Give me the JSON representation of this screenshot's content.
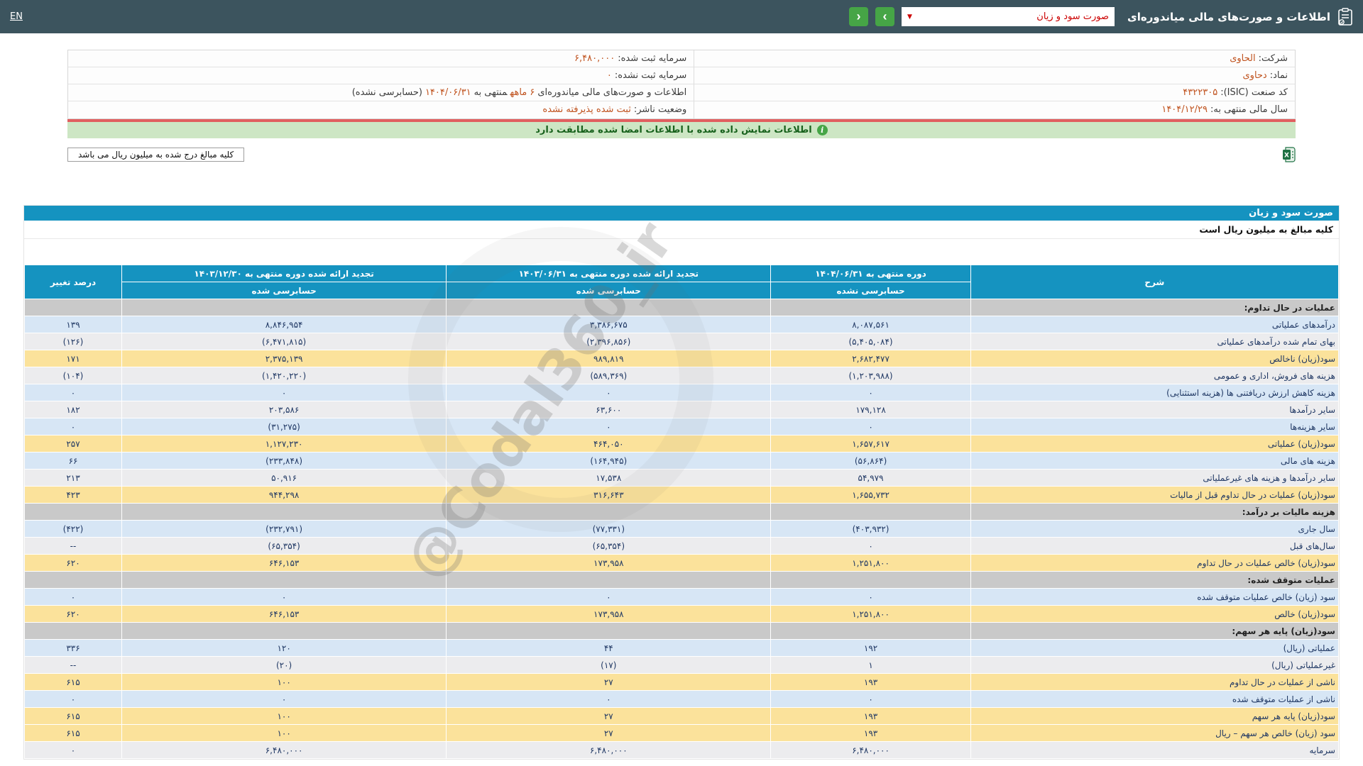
{
  "colors": {
    "header_bg": "#3c545e",
    "cyan": "#1593c0",
    "green_btn": "#46a546",
    "accent": "#c0531f",
    "red_line": "#e15f5f",
    "notice_bg": "#cde6c4",
    "row_blue": "#d7e6f5",
    "row_gray": "#ececee",
    "row_yellow": "#fbe29b",
    "section_gray": "#c9c9c9",
    "val_navy": "#203864",
    "neg_red": "#e00000"
  },
  "header": {
    "title": "اطلاعات و صورت‌های مالی میاندوره‌ای",
    "dropdown_value": "صورت سود و زیان",
    "dropdown_arrow_glyph": "▼",
    "next_glyph": "›",
    "prev_glyph": "‹",
    "lang": "EN",
    "icons": {
      "clipboard": "clipboard-icon",
      "next": "chevron-right-icon",
      "prev": "chevron-left-icon",
      "dropdown": "chevron-down-icon"
    }
  },
  "company_info": {
    "right_rows": [
      {
        "parts": [
          {
            "t": "شرکت:",
            "c": "label"
          },
          {
            "t": "الحاوی",
            "c": "value"
          }
        ]
      },
      {
        "parts": [
          {
            "t": "نماد:",
            "c": "label"
          },
          {
            "t": "دحاوی",
            "c": "value"
          }
        ]
      },
      {
        "parts": [
          {
            "t": "کد صنعت (ISIC):",
            "c": "label"
          },
          {
            "t": "۴۳۲۲۳۰۵",
            "c": "value"
          }
        ]
      },
      {
        "parts": [
          {
            "t": "سال مالی منتهی به:",
            "c": "label"
          },
          {
            "t": "۱۴۰۴/۱۲/۲۹",
            "c": "value"
          }
        ]
      }
    ],
    "left_rows": [
      {
        "parts": [
          {
            "t": "سرمایه ثبت شده:",
            "c": "label"
          },
          {
            "t": "۶,۴۸۰,۰۰۰",
            "c": "value"
          }
        ]
      },
      {
        "parts": [
          {
            "t": "سرمایه ثبت نشده:",
            "c": "label"
          },
          {
            "t": "۰",
            "c": "value"
          }
        ]
      },
      {
        "parts": [
          {
            "t": "اطلاعات و صورت‌های مالی میاندوره‌ای",
            "c": "label"
          },
          {
            "t": "۶ ماهه",
            "c": "value"
          },
          {
            "t": "منتهی به",
            "c": "label"
          },
          {
            "t": "۱۴۰۴/۰۶/۳۱",
            "c": "value"
          },
          {
            "t": "(حسابرسی نشده)",
            "c": "label"
          }
        ]
      },
      {
        "parts": [
          {
            "t": "وضعیت ناشر:",
            "c": "label"
          },
          {
            "t": "ثبت شده پذیرفته نشده",
            "c": "value"
          }
        ]
      }
    ]
  },
  "notice": {
    "icon_glyph": "i",
    "text": "اطلاعات نمایش داده شده با اطلاعات امضا شده مطابقت دارد"
  },
  "unit_note_box": "کلیه مبالغ درج شده به میلیون ریال می باشد",
  "excel_icon": "excel-export-icon",
  "statement": {
    "title": "صورت سود و زیان",
    "unit_note": "کلیه مبالغ به میلیون ریال است"
  },
  "table": {
    "headers": {
      "desc": "شرح",
      "p1": {
        "line1": "دوره منتهی به ۱۴۰۴/۰۶/۳۱",
        "line2": "حسابرسی نشده"
      },
      "p2": {
        "line1": "تجدید ارائه شده دوره منتهی به ۱۴۰۳/۰۶/۳۱",
        "line2": "حسابرسی شده"
      },
      "p3": {
        "line1": "تجدید ارائه شده دوره منتهی به ۱۴۰۳/۱۲/۳۰",
        "line2": "حسابرسی شده"
      },
      "change": "درصد تغییر"
    },
    "rows": [
      {
        "type": "section",
        "label": "عملیات در حال تداوم:"
      },
      {
        "type": "data",
        "bg": "blue",
        "label": "درآمدهای عملیاتی",
        "v1": "۸,۰۸۷,۵۶۱",
        "v2": "۳,۳۸۶,۶۷۵",
        "v3": "۸,۸۴۶,۹۵۴",
        "pct": "۱۳۹"
      },
      {
        "type": "data",
        "bg": "gray",
        "label": "بهای تمام شده درآمدهای عملیاتی",
        "v1": "(۵,۴۰۵,۰۸۴)",
        "v2": "(۲,۳۹۶,۸۵۶)",
        "v3": "(۶,۴۷۱,۸۱۵)",
        "pct": "(۱۲۶)"
      },
      {
        "type": "data",
        "bg": "yellow",
        "label": "سود(زیان) ناخالص",
        "v1": "۲,۶۸۲,۴۷۷",
        "v2": "۹۸۹,۸۱۹",
        "v3": "۲,۳۷۵,۱۳۹",
        "pct": "۱۷۱"
      },
      {
        "type": "data",
        "bg": "gray",
        "label": "هزینه های فروش، اداری و عمومی",
        "v1": "(۱,۲۰۳,۹۸۸)",
        "v2": "(۵۸۹,۳۶۹)",
        "v3": "(۱,۴۲۰,۲۲۰)",
        "pct": "(۱۰۴)"
      },
      {
        "type": "data",
        "bg": "blue",
        "label": "هزینه کاهش ارزش دریافتنی ها (هزینه استثنایی)",
        "v1": "۰",
        "v2": "۰",
        "v3": "۰",
        "pct": "۰"
      },
      {
        "type": "data",
        "bg": "gray",
        "label": "سایر درآمدها",
        "v1": "۱۷۹,۱۲۸",
        "v2": "۶۳,۶۰۰",
        "v3": "۲۰۳,۵۸۶",
        "pct": "۱۸۲"
      },
      {
        "type": "data",
        "bg": "blue",
        "label": "سایر هزینه‌ها",
        "v1": "۰",
        "v2": "۰",
        "v3": "(۳۱,۲۷۵)",
        "pct": "۰"
      },
      {
        "type": "data",
        "bg": "yellow",
        "label": "سود(زیان) عملیاتی",
        "v1": "۱,۶۵۷,۶۱۷",
        "v2": "۴۶۴,۰۵۰",
        "v3": "۱,۱۲۷,۲۳۰",
        "pct": "۲۵۷"
      },
      {
        "type": "data",
        "bg": "blue",
        "label": "هزینه های مالی",
        "v1": "(۵۶,۸۶۴)",
        "v2": "(۱۶۴,۹۴۵)",
        "v3": "(۲۳۳,۸۴۸)",
        "pct": "۶۶"
      },
      {
        "type": "data",
        "bg": "gray",
        "label": "سایر درآمدها و هزینه های غیرعملیاتی",
        "v1": "۵۴,۹۷۹",
        "v2": "۱۷,۵۳۸",
        "v3": "۵۰,۹۱۶",
        "pct": "۲۱۳"
      },
      {
        "type": "data",
        "bg": "yellow",
        "label": "سود(زیان) عملیات در حال تداوم قبل از مالیات",
        "v1": "۱,۶۵۵,۷۳۲",
        "v2": "۳۱۶,۶۴۳",
        "v3": "۹۴۴,۲۹۸",
        "pct": "۴۲۳"
      },
      {
        "type": "section",
        "label": "هزینه مالیات بر درآمد:"
      },
      {
        "type": "data",
        "bg": "blue",
        "label": "سال جاری",
        "v1": "(۴۰۳,۹۳۲)",
        "v2": "(۷۷,۳۳۱)",
        "v3": "(۲۳۲,۷۹۱)",
        "pct": "(۴۲۲)"
      },
      {
        "type": "data",
        "bg": "gray",
        "label": "سال‌های قبل",
        "v1": "۰",
        "v2": "(۶۵,۳۵۴)",
        "v3": "(۶۵,۳۵۴)",
        "pct": "--"
      },
      {
        "type": "data",
        "bg": "yellow",
        "label": "سود(زیان) خالص عملیات در حال تداوم",
        "v1": "۱,۲۵۱,۸۰۰",
        "v2": "۱۷۳,۹۵۸",
        "v3": "۶۴۶,۱۵۳",
        "pct": "۶۲۰"
      },
      {
        "type": "section",
        "label": "عملیات متوقف شده:"
      },
      {
        "type": "data",
        "bg": "blue",
        "label": "سود (زیان) خالص عملیات متوقف شده",
        "v1": "۰",
        "v2": "۰",
        "v3": "۰",
        "pct": "۰"
      },
      {
        "type": "data",
        "bg": "yellow",
        "label": "سود(زیان) خالص",
        "v1": "۱,۲۵۱,۸۰۰",
        "v2": "۱۷۳,۹۵۸",
        "v3": "۶۴۶,۱۵۳",
        "pct": "۶۲۰"
      },
      {
        "type": "section",
        "label": "سود(زیان) پایه هر سهم:"
      },
      {
        "type": "data",
        "bg": "blue",
        "label": "عملیاتی (ریال)",
        "v1": "۱۹۲",
        "v2": "۴۴",
        "v3": "۱۲۰",
        "pct": "۳۳۶"
      },
      {
        "type": "data",
        "bg": "gray",
        "label": "غیرعملیاتی (ریال)",
        "v1": "۱",
        "v2": "(۱۷)",
        "v3": "(۲۰)",
        "pct": "--"
      },
      {
        "type": "data",
        "bg": "yellow",
        "label": "ناشی از عملیات در حال تداوم",
        "v1": "۱۹۳",
        "v2": "۲۷",
        "v3": "۱۰۰",
        "pct": "۶۱۵"
      },
      {
        "type": "data",
        "bg": "blue",
        "label": "ناشی از عملیات متوقف شده",
        "v1": "۰",
        "v2": "۰",
        "v3": "۰",
        "pct": "۰"
      },
      {
        "type": "data",
        "bg": "yellow",
        "label": "سود(زیان) پایه هر سهم",
        "v1": "۱۹۳",
        "v2": "۲۷",
        "v3": "۱۰۰",
        "pct": "۶۱۵"
      },
      {
        "type": "data",
        "bg": "yellow",
        "label": "سود (زیان) خالص هر سهم – ریال",
        "v1": "۱۹۳",
        "v2": "۲۷",
        "v3": "۱۰۰",
        "pct": "۶۱۵"
      },
      {
        "type": "data",
        "bg": "gray",
        "label": "سرمایه",
        "v1": "۶,۴۸۰,۰۰۰",
        "v2": "۶,۴۸۰,۰۰۰",
        "v3": "۶,۴۸۰,۰۰۰",
        "pct": "۰"
      }
    ]
  },
  "watermark": {
    "text": "@Codal360_ir"
  }
}
